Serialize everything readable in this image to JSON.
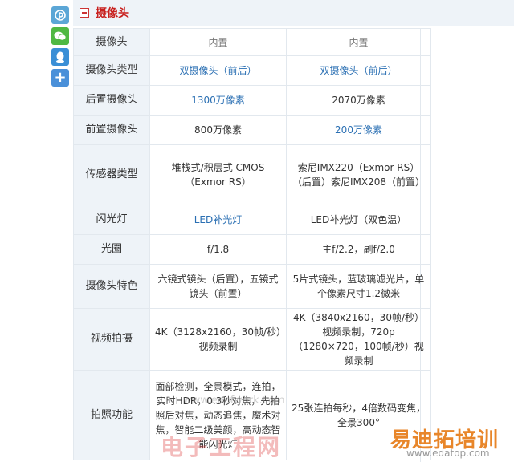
{
  "section": {
    "title": "摄像头"
  },
  "share": [
    {
      "name": "pinterest",
      "color": "#5ba6d6"
    },
    {
      "name": "wechat",
      "color": "#4fb843"
    },
    {
      "name": "qq",
      "color": "#3a8fd6"
    },
    {
      "name": "plus",
      "glyph": "+",
      "color": "#4a90d9"
    }
  ],
  "rows": [
    {
      "label": "摄像头",
      "v1": "内置",
      "v2": "内置"
    },
    {
      "label": "摄像头类型",
      "v1": "双摄像头（前后）",
      "v2": "双摄像头（前后）"
    },
    {
      "label": "后置摄像头",
      "v1": "1300万像素",
      "v2": "2070万像素"
    },
    {
      "label": "前置摄像头",
      "v1": "800万像素",
      "v2": "200万像素"
    },
    {
      "label": "传感器类型",
      "v1": "堆栈式/积层式 CMOS（Exmor RS）",
      "v2": "索尼IMX220（Exmor RS）（后置）索尼IMX208（前置）"
    },
    {
      "label": "闪光灯",
      "v1": "LED补光灯",
      "v2": "LED补光灯（双色温）"
    },
    {
      "label": "光圈",
      "v1": "f/1.8",
      "v2": "主f/2.2，副f/2.0"
    },
    {
      "label": "摄像头特色",
      "v1": "六镜式镜头（后置），五镜式镜头（前置）",
      "v2": "5片式镜头，蓝玻璃滤光片，单个像素尺寸1.2微米"
    },
    {
      "label": "视频拍摄",
      "v1": "4K（3128x2160，30帧/秒）视频录制",
      "v2": "4K（3840x2160，30帧/秒）视频录制，720p（1280×720，100帧/秒）视频录制"
    },
    {
      "label": "拍照功能",
      "v1": "面部检测，全景模式，连拍，实时HDR，0.3秒对焦，先拍照后对焦，动态追焦，魔术对焦，智能二级美颜，高动态智能闪光灯",
      "v2": "25张连拍每秒，4倍数码变焦，全景300°"
    }
  ],
  "watermarks": {
    "left": "电子工程网",
    "mid": "www.eeofwork.com",
    "right_top": "易迪拓培训",
    "right_bottom": "www.edatop.com"
  }
}
